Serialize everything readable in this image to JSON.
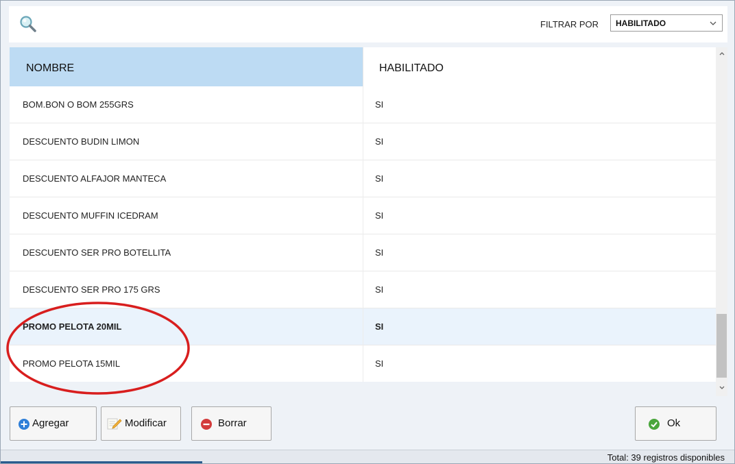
{
  "toolbar": {
    "search_icon": "magnifier-icon",
    "filter_label": "FILTRAR POR",
    "filter_value": "HABILITADO"
  },
  "grid": {
    "columns": [
      "NOMBRE",
      "HABILITADO"
    ],
    "rows": [
      {
        "nombre": "BOM.BON O BOM 255GRS",
        "habilitado": "SI"
      },
      {
        "nombre": "DESCUENTO BUDIN LIMON",
        "habilitado": "SI"
      },
      {
        "nombre": "DESCUENTO ALFAJOR MANTECA",
        "habilitado": "SI"
      },
      {
        "nombre": "DESCUENTO MUFFIN ICEDRAM",
        "habilitado": "SI"
      },
      {
        "nombre": "DESCUENTO SER PRO BOTELLITA",
        "habilitado": "SI"
      },
      {
        "nombre": "DESCUENTO SER PRO 175 GRS",
        "habilitado": "SI"
      },
      {
        "nombre": "PROMO PELOTA 20MIL",
        "habilitado": "SI"
      },
      {
        "nombre": "PROMO PELOTA 15MIL",
        "habilitado": "SI"
      }
    ],
    "selected_row_index": 6
  },
  "buttons": {
    "add": "Agregar",
    "modify": "Modificar",
    "delete": "Borrar",
    "ok": "Ok"
  },
  "status": {
    "total_text": "Total: 39 registros disponibles"
  },
  "colors": {
    "header_accent": "#bddbf3",
    "selected_row": "#eaf3fc",
    "annotation_circle": "#d81e1e",
    "add_icon": "#2f7fd8",
    "delete_icon": "#d33b3b",
    "ok_icon": "#4aa63c"
  }
}
